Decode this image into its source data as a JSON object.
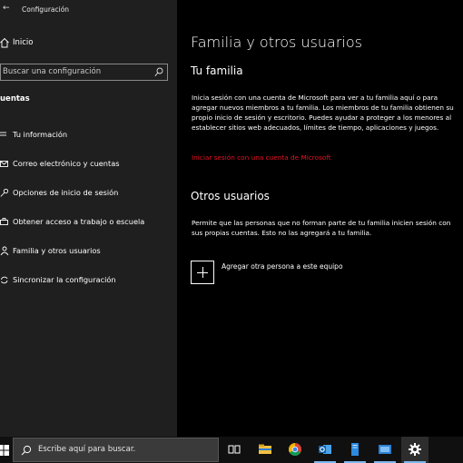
{
  "window": {
    "title": "Configuración"
  },
  "sidebar": {
    "home_label": "Inicio",
    "search_placeholder": "Buscar una configuración",
    "section_title": "uentas",
    "items": [
      {
        "label": "Tu información",
        "icon": "person-icon"
      },
      {
        "label": "Correo electrónico y cuentas",
        "icon": "mail-icon"
      },
      {
        "label": "Opciones de inicio de sesión",
        "icon": "key-icon"
      },
      {
        "label": "Obtener acceso a trabajo o escuela",
        "icon": "briefcase-icon"
      },
      {
        "label": "Familia y otros usuarios",
        "icon": "family-icon"
      },
      {
        "label": "Sincronizar la configuración",
        "icon": "sync-icon"
      }
    ]
  },
  "main": {
    "title": "Familia y otros usuarios",
    "family": {
      "heading": "Tu familia",
      "description": "Inicia sesión con una cuenta de Microsoft para ver a tu familia aquí o para agregar nuevos miembros a tu familia. Los miembros de tu familia obtienen su propio inicio de sesión y escritorio. Puedes ayudar a proteger a los menores al establecer sitios web adecuados, límites de tiempo, aplicaciones y juegos.",
      "link": "Iniciar sesión con una cuenta de Microsoft"
    },
    "others": {
      "heading": "Otros usuarios",
      "description": "Permite que las personas que no forman parte de tu familia inicien sesión con sus propias cuentas. Esto no las agregará a tu familia.",
      "add_label": "Agregar otra persona a este equipo"
    }
  },
  "taskbar": {
    "search_placeholder": "Escribe aquí para buscar.",
    "apps": [
      "task-view-icon",
      "file-explorer-icon",
      "chrome-icon",
      "outlook-icon",
      "word-icon",
      "app-icon",
      "settings-icon"
    ]
  },
  "colors": {
    "link": "#e81123",
    "sidebar_bg": "#1f1f1f",
    "main_bg": "#000000",
    "taskbar_bg": "#101010"
  }
}
